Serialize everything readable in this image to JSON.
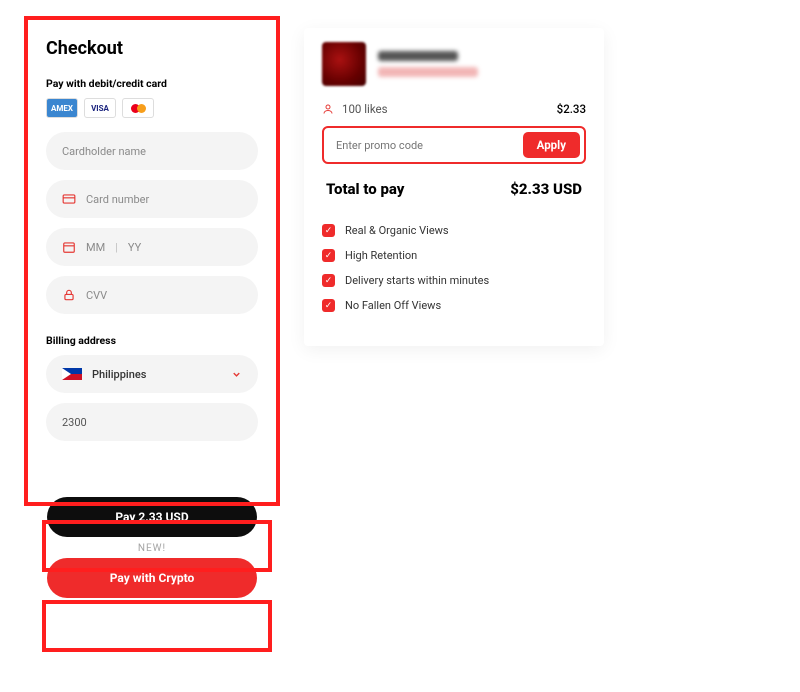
{
  "checkout": {
    "title": "Checkout",
    "pay_with_label": "Pay with debit/credit card",
    "logos": {
      "amex": "AMEX",
      "visa": "VISA"
    },
    "fields": {
      "cardholder_ph": "Cardholder name",
      "cardnumber_ph": "Card number",
      "exp_mm_ph": "MM",
      "exp_yy_ph": "YY",
      "cvv_ph": "CVV"
    },
    "billing_label": "Billing address",
    "country": "Philippines",
    "postal": "2300"
  },
  "buttons": {
    "pay_label": "Pay 2.33 USD",
    "new_badge": "NEW!",
    "crypto_label": "Pay with Crypto"
  },
  "summary": {
    "likes_label": "100 likes",
    "likes_price": "$2.33",
    "promo_ph": "Enter promo code",
    "apply_label": "Apply",
    "total_label": "Total to pay",
    "total_value": "$2.33 USD",
    "features": [
      "Real & Organic Views",
      "High Retention",
      "Delivery starts within minutes",
      "No Fallen Off Views"
    ]
  }
}
